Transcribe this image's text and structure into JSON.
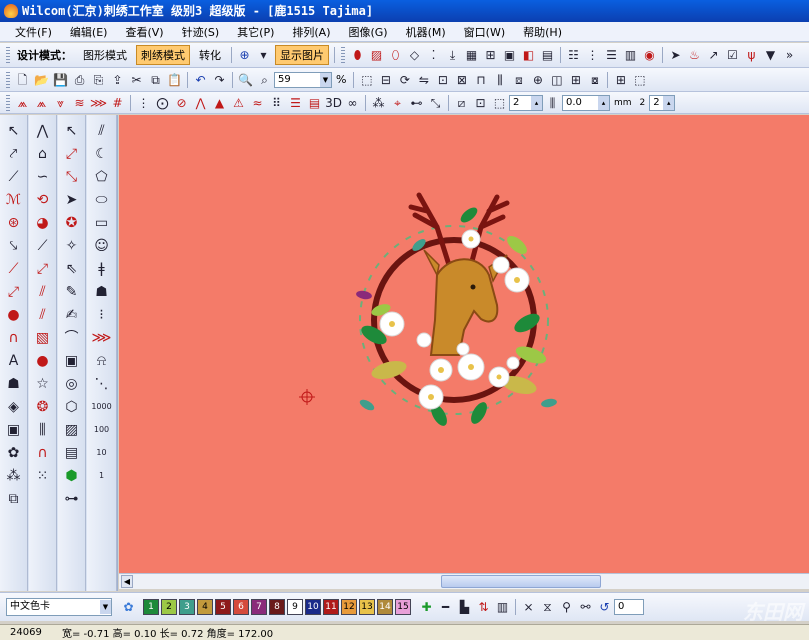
{
  "window": {
    "title": "Wilcom(汇京)刺绣工作室  级别3 超级版 - [鹿1515          Tajima]"
  },
  "menu": [
    {
      "label": "文件(F)"
    },
    {
      "label": "编辑(E)"
    },
    {
      "label": "查看(V)"
    },
    {
      "label": "针迹(S)"
    },
    {
      "label": "其它(P)"
    },
    {
      "label": "排列(A)"
    },
    {
      "label": "图像(G)"
    },
    {
      "label": "机器(M)"
    },
    {
      "label": "窗口(W)"
    },
    {
      "label": "帮助(H)"
    }
  ],
  "mode_toolbar": {
    "design_mode_label": "设计模式：",
    "graphic_mode": "图形模式",
    "embroidery_mode": "刺绣模式",
    "convert": "转化",
    "show_picture": "显示图片"
  },
  "standard_toolbar": {
    "zoom_value": "59",
    "zoom_unit": "%"
  },
  "stitch_toolbar": {
    "field_a": "2",
    "field_b": "0.0",
    "unit_a": "mm",
    "unit_b": "2",
    "field_c": "2"
  },
  "colorbar": {
    "palette_select": "中文色卡",
    "swatches": [
      {
        "num": "1",
        "color": "#1e8a3a"
      },
      {
        "num": "2",
        "color": "#9cc846"
      },
      {
        "num": "3",
        "color": "#3f9e8c"
      },
      {
        "num": "4",
        "color": "#c29a3c"
      },
      {
        "num": "5",
        "color": "#8e1a1a"
      },
      {
        "num": "6",
        "color": "#d54a3c"
      },
      {
        "num": "7",
        "color": "#8a2a7a"
      },
      {
        "num": "8",
        "color": "#6a1a1a"
      },
      {
        "num": "9",
        "color": "#ffffff"
      },
      {
        "num": "10",
        "color": "#1a2a8a"
      },
      {
        "num": "11",
        "color": "#b01a1a"
      },
      {
        "num": "12",
        "color": "#e89a3a"
      },
      {
        "num": "13",
        "color": "#e8c24a"
      },
      {
        "num": "14",
        "color": "#b08a3a"
      },
      {
        "num": "15",
        "color": "#e8a0d8"
      }
    ],
    "rotate_value": "0"
  },
  "status": {
    "stitch_count": "24069",
    "info": "宽= -0.71  高= 0.10  长= 0.72  角度= 172.00"
  },
  "watermark": "东田网"
}
